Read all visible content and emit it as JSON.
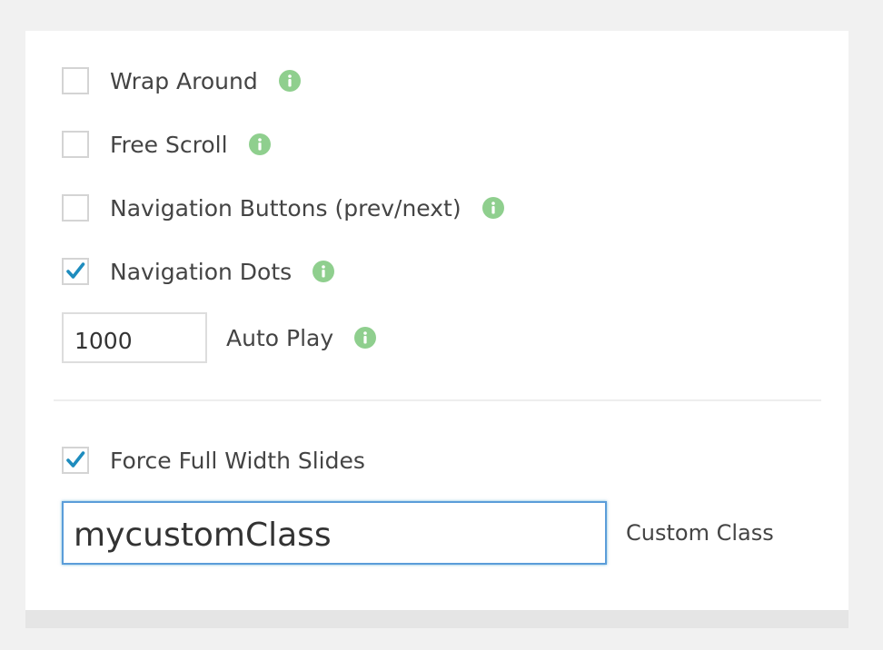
{
  "options": [
    {
      "label": "Wrap Around",
      "checked": false
    },
    {
      "label": "Free Scroll",
      "checked": false
    },
    {
      "label": "Navigation Buttons (prev/next)",
      "checked": false
    },
    {
      "label": "Navigation Dots",
      "checked": true
    }
  ],
  "autoplay": {
    "value": "1000",
    "label": "Auto Play"
  },
  "force_full_width": {
    "label": "Force Full Width Slides",
    "checked": true
  },
  "custom_class": {
    "value": "mycustomClass",
    "label": "Custom Class"
  },
  "colors": {
    "info_icon": "#8fcf8e",
    "checkmark": "#1e8cbe",
    "focus_border": "#5b9dd9"
  },
  "icons": {
    "info": "info-icon",
    "check": "checkmark-icon"
  }
}
